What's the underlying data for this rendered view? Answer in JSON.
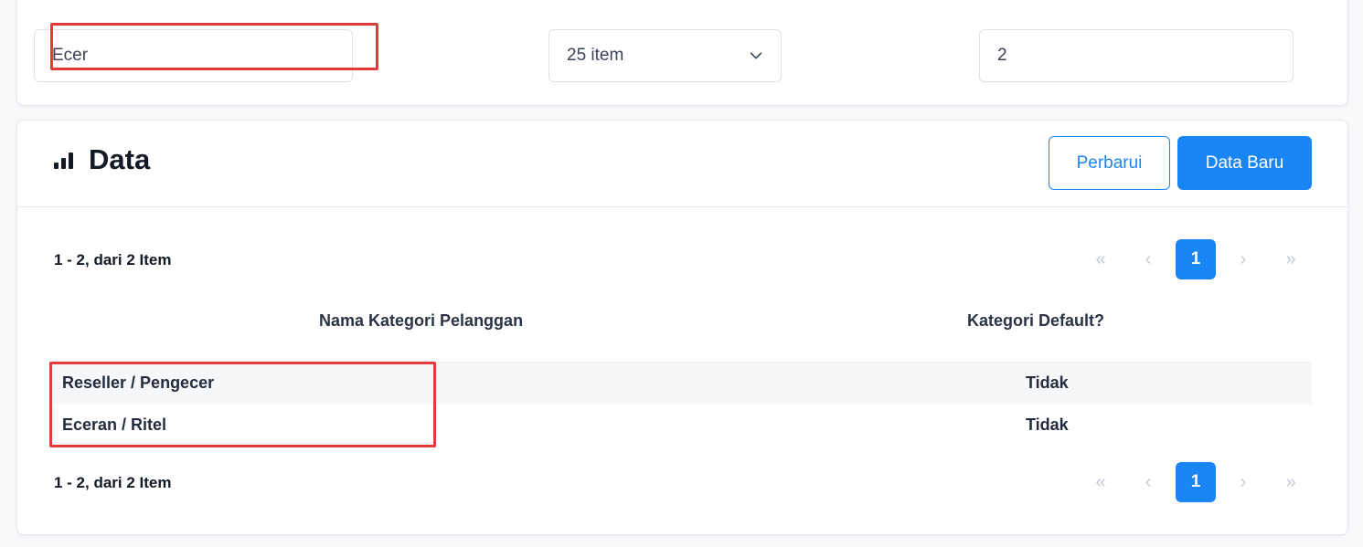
{
  "filters": {
    "name_value": "Ecer",
    "per_page_value": "25 item",
    "page_value": "2"
  },
  "data_panel": {
    "title": "Data",
    "refresh_label": "Perbarui",
    "new_label": "Data Baru",
    "summary": "1 - 2, dari 2 Item",
    "pagination": {
      "first": "«",
      "prev": "‹",
      "current": "1",
      "next": "›",
      "last": "»"
    },
    "columns": [
      "Nama Kategori Pelanggan",
      "Kategori Default?"
    ],
    "rows": [
      {
        "name": "Reseller / Pengecer",
        "default": "Tidak"
      },
      {
        "name": "Eceran / Ritel",
        "default": "Tidak"
      }
    ]
  },
  "colors": {
    "primary": "#1a86f5",
    "highlight": "#e53a3a"
  },
  "icons": {
    "title_icon": "bar-chart-icon",
    "select_icon": "chevron-down-icon"
  }
}
